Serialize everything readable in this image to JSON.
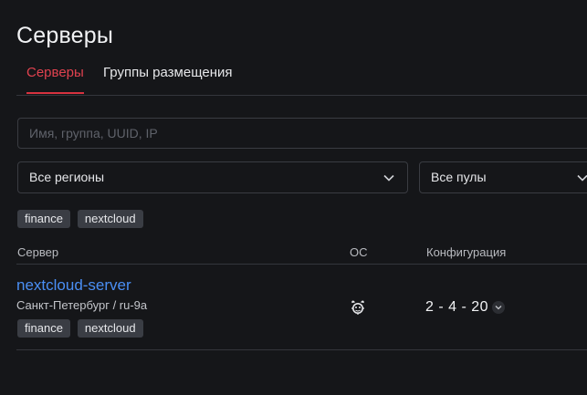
{
  "page": {
    "title": "Серверы"
  },
  "tabs": [
    {
      "label": "Серверы",
      "active": true
    },
    {
      "label": "Группы размещения",
      "active": false
    }
  ],
  "search": {
    "placeholder": "Имя, группа, UUID, IP",
    "value": ""
  },
  "filters": {
    "region": {
      "selected": "Все регионы"
    },
    "pool": {
      "selected": "Все пулы"
    },
    "tags": [
      "finance",
      "nextcloud"
    ]
  },
  "table": {
    "headers": {
      "server": "Сервер",
      "os": "ОС",
      "config": "Конфигурация"
    },
    "rows": [
      {
        "name": "nextcloud-server",
        "location": "Санкт-Петербург / ru-9a",
        "tags": [
          "finance",
          "nextcloud"
        ],
        "os_icon": "freebsd-icon",
        "config": "2 - 4 - 20"
      }
    ]
  },
  "colors": {
    "background": "#151619",
    "accent": "#e0424f",
    "link": "#4a8ff5",
    "chip": "#3a3d44",
    "border": "#3a3c42"
  }
}
